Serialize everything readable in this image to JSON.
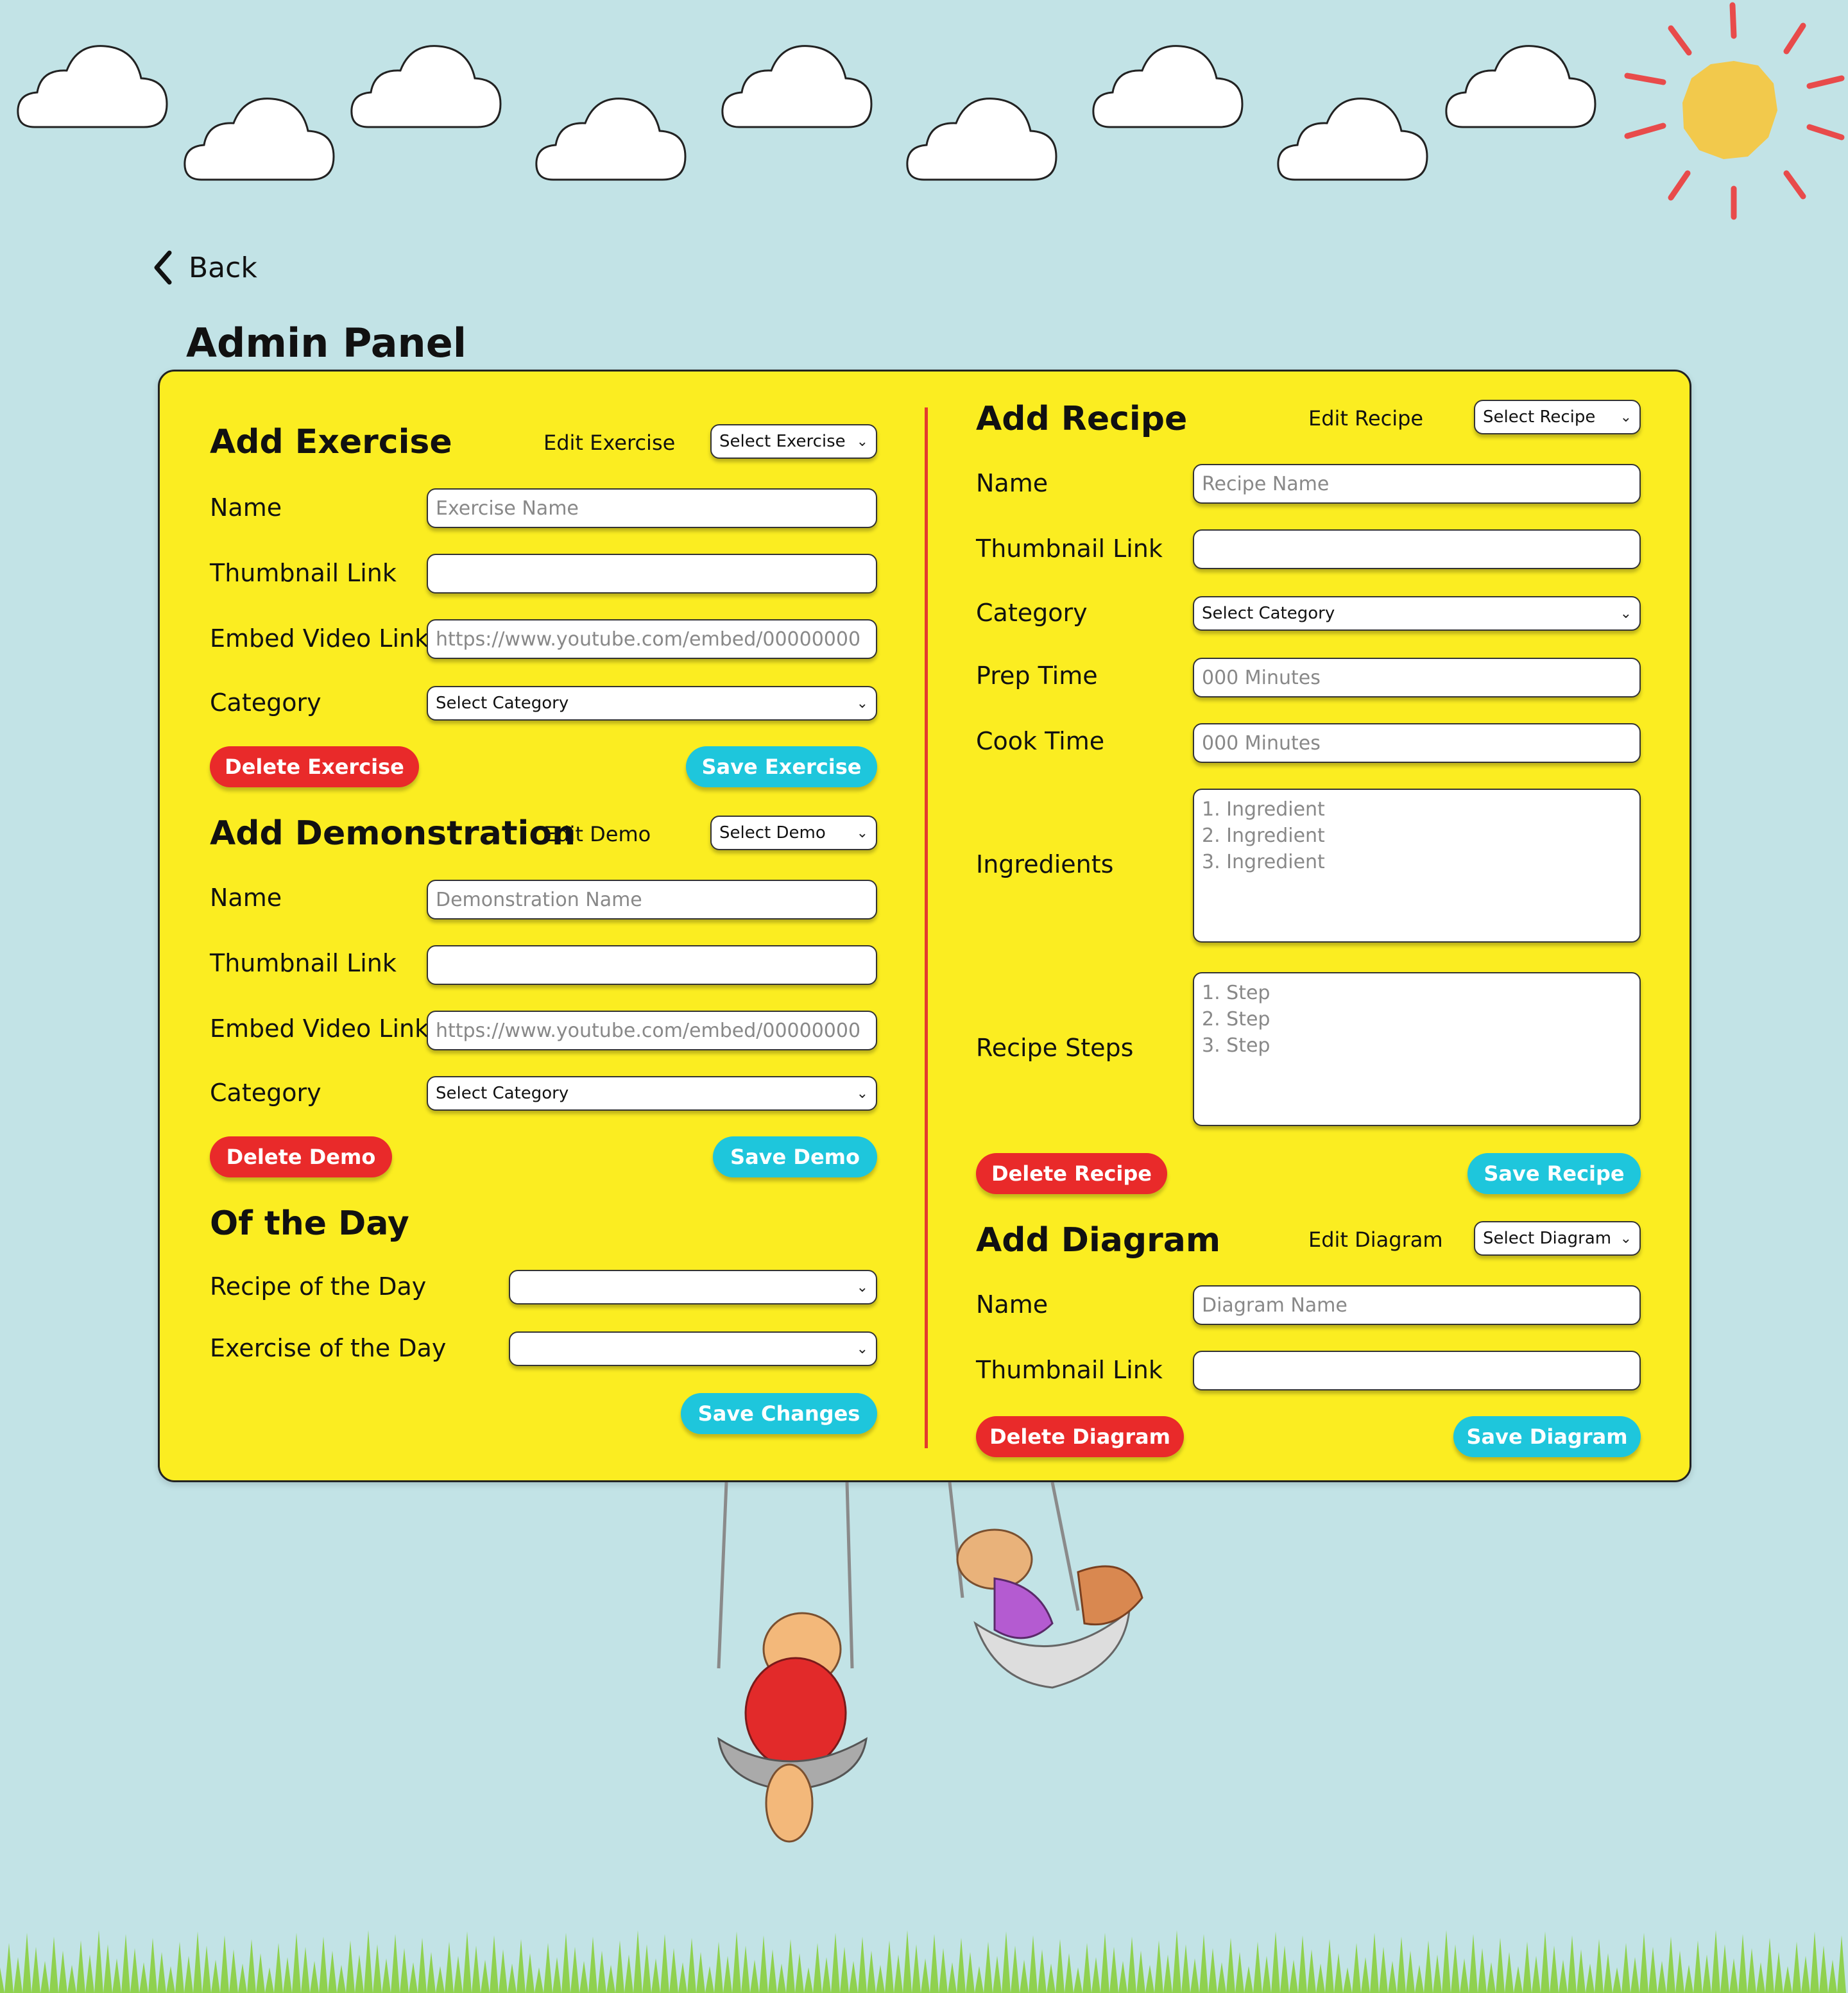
{
  "nav": {
    "back_label": "Back"
  },
  "page": {
    "title": "Admin Panel"
  },
  "exercise": {
    "title": "Add Exercise",
    "edit_label": "Edit Exercise",
    "select_value": "Select Exercise",
    "name_label": "Name",
    "name_placeholder": "Exercise Name",
    "thumb_label": "Thumbnail Link",
    "thumb_value": "",
    "embed_label": "Embed Video Link",
    "embed_placeholder": "https://www.youtube.com/embed/00000000",
    "category_label": "Category",
    "category_value": "Select Category",
    "delete_label": "Delete Exercise",
    "save_label": "Save Exercise"
  },
  "demo": {
    "title": "Add Demonstration",
    "edit_label": "Edit Demo",
    "select_value": "Select Demo",
    "name_label": "Name",
    "name_placeholder": "Demonstration Name",
    "thumb_label": "Thumbnail Link",
    "thumb_value": "",
    "embed_label": "Embed Video Link",
    "embed_placeholder": "https://www.youtube.com/embed/00000000",
    "category_label": "Category",
    "category_value": "Select Category",
    "delete_label": "Delete Demo",
    "save_label": "Save Demo"
  },
  "of_the_day": {
    "title": "Of the Day",
    "recipe_label": "Recipe of the Day",
    "recipe_value": "",
    "exercise_label": "Exercise of the Day",
    "exercise_value": "",
    "save_label": "Save Changes"
  },
  "recipe": {
    "title": "Add Recipe",
    "edit_label": "Edit Recipe",
    "select_value": "Select Recipe",
    "name_label": "Name",
    "name_placeholder": "Recipe Name",
    "thumb_label": "Thumbnail Link",
    "thumb_value": "",
    "category_label": "Category",
    "category_value": "Select Category",
    "prep_label": "Prep Time",
    "prep_placeholder": "000 Minutes",
    "cook_label": "Cook Time",
    "cook_placeholder": "000 Minutes",
    "ingredients_label": "Ingredients",
    "ingredients_placeholder": "1. Ingredient\n2. Ingredient\n3. Ingredient",
    "steps_label": "Recipe Steps",
    "steps_placeholder": "1. Step\n2. Step\n3. Step",
    "delete_label": "Delete Recipe",
    "save_label": "Save Recipe"
  },
  "diagram": {
    "title": "Add Diagram",
    "edit_label": "Edit Diagram",
    "select_value": "Select Diagram",
    "name_label": "Name",
    "name_placeholder": "Diagram Name",
    "thumb_label": "Thumbnail Link",
    "thumb_value": "",
    "delete_label": "Delete Diagram",
    "save_label": "Save Diagram"
  },
  "colors": {
    "background": "#c2e3e6",
    "panel": "#fbed21",
    "danger": "#e92a2a",
    "primary": "#1ec6dc",
    "divider": "#e33b2d",
    "sun": "#f2c94c",
    "sun_rays": "#e84b4b",
    "grass": "#8fd14f"
  },
  "icons": {
    "back": "chevron-left-icon",
    "dropdown": "chevron-down-icon"
  }
}
